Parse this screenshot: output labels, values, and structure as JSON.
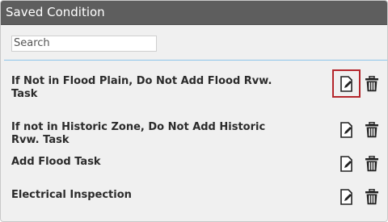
{
  "panel": {
    "title": "Saved Condition"
  },
  "search": {
    "placeholder": "Search",
    "value": ""
  },
  "conditions": [
    {
      "label": "If Not in Flood Plain, Do Not Add Flood Rvw. Task",
      "icon_edit": "edit-document-icon",
      "icon_delete": "trash-icon"
    },
    {
      "label": "If not in Historic Zone, Do Not Add Historic Rvw. Task",
      "icon_edit": "edit-document-icon",
      "icon_delete": "trash-icon"
    },
    {
      "label": "Add Flood Task",
      "icon_edit": "edit-document-icon",
      "icon_delete": "trash-icon"
    },
    {
      "label": "Electrical Inspection",
      "icon_edit": "edit-document-icon",
      "icon_delete": "trash-icon"
    }
  ],
  "colors": {
    "header_bg": "#5e5e5e",
    "panel_bg": "#f0f0f0",
    "divider": "#8ec5ea",
    "focus_outline": "#b4262c",
    "text": "#2b2b2b"
  }
}
